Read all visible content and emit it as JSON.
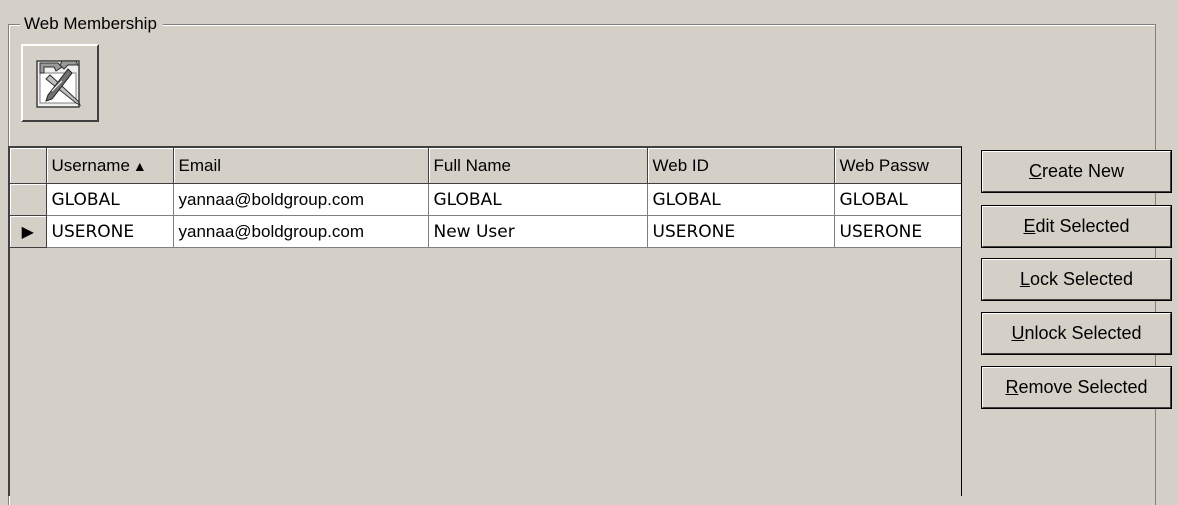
{
  "group": {
    "title": "Web Membership"
  },
  "toolbar": {
    "tool_icon": "tools-icon"
  },
  "grid": {
    "columns": [
      {
        "label": "Username",
        "sort": "ascending"
      },
      {
        "label": "Email"
      },
      {
        "label": "Full Name"
      },
      {
        "label": "Web ID"
      },
      {
        "label": "Web Passw"
      }
    ],
    "rows": [
      {
        "current": false,
        "cells": [
          "GLOBAL",
          "yannaa@boldgroup.com",
          "GLOBAL",
          "GLOBAL",
          "GLOBAL"
        ]
      },
      {
        "current": true,
        "cells": [
          "USERONE",
          "yannaa@boldgroup.com",
          "New User",
          "USERONE",
          "USERONE"
        ]
      }
    ],
    "current_row_icon": "row-pointer-icon",
    "sort_icon": "sort-ascending-icon"
  },
  "actions": {
    "create_new": {
      "accel": "C",
      "rest": "reate New"
    },
    "edit_selected": {
      "accel": "E",
      "rest": "dit Selected"
    },
    "lock_selected": {
      "accel": "L",
      "rest": "ock Selected"
    },
    "unlock_selected": {
      "accel": "U",
      "rest": "nlock Selected"
    },
    "remove_selected": {
      "accel": "R",
      "rest": "emove Selected"
    }
  }
}
